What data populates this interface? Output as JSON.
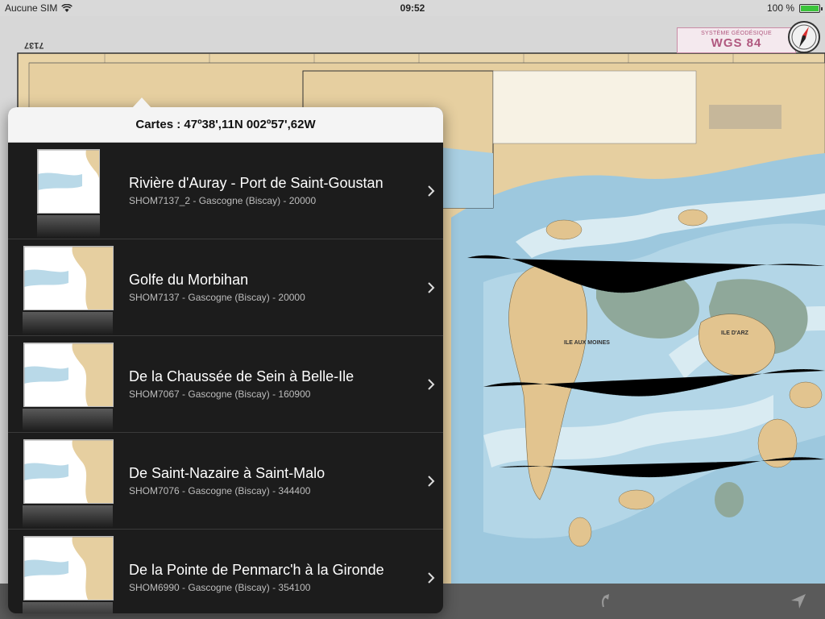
{
  "status_bar": {
    "carrier": "Aucune SIM",
    "time": "09:52",
    "battery_label": "100 %",
    "battery_level": 1.0
  },
  "map": {
    "chart_number": "7137",
    "datum_small": "SYSTÈME GÉODÉSIQUE",
    "datum": "WGS 84",
    "labels": {
      "ile_aux_moines": "ILE AUX MOINES",
      "ile_d_arz": "ILE D'ARZ"
    },
    "colors": {
      "land": "#e6cfa0",
      "deep": "#9dc8de",
      "shallow": "#c8e0ea",
      "drying": "#8fa89a"
    }
  },
  "popover": {
    "title": "Cartes : 47º38',11N 002º57',62W",
    "items": [
      {
        "title": "Rivière d'Auray - Port de Saint-Goustan",
        "subtitle": "SHOM7137_2 - Gascogne (Biscay)  - 20000",
        "thumb": "portrait"
      },
      {
        "title": "Golfe du Morbihan",
        "subtitle": "SHOM7137 - Gascogne (Biscay)  - 20000",
        "thumb": "landscape"
      },
      {
        "title": "De la Chaussée de Sein à Belle-Ile",
        "subtitle": "SHOM7067 - Gascogne (Biscay)  - 160900",
        "thumb": "landscape"
      },
      {
        "title": "De Saint-Nazaire à Saint-Malo",
        "subtitle": "SHOM7076 - Gascogne (Biscay)  - 344400",
        "thumb": "landscape"
      },
      {
        "title": "De la Pointe de Penmarc'h à la Gironde",
        "subtitle": "SHOM6990 - Gascogne (Biscay)  - 354100",
        "thumb": "landscape"
      }
    ]
  },
  "toolbar": {
    "icons": [
      "return-arrow-icon",
      "location-arrow-icon"
    ]
  }
}
